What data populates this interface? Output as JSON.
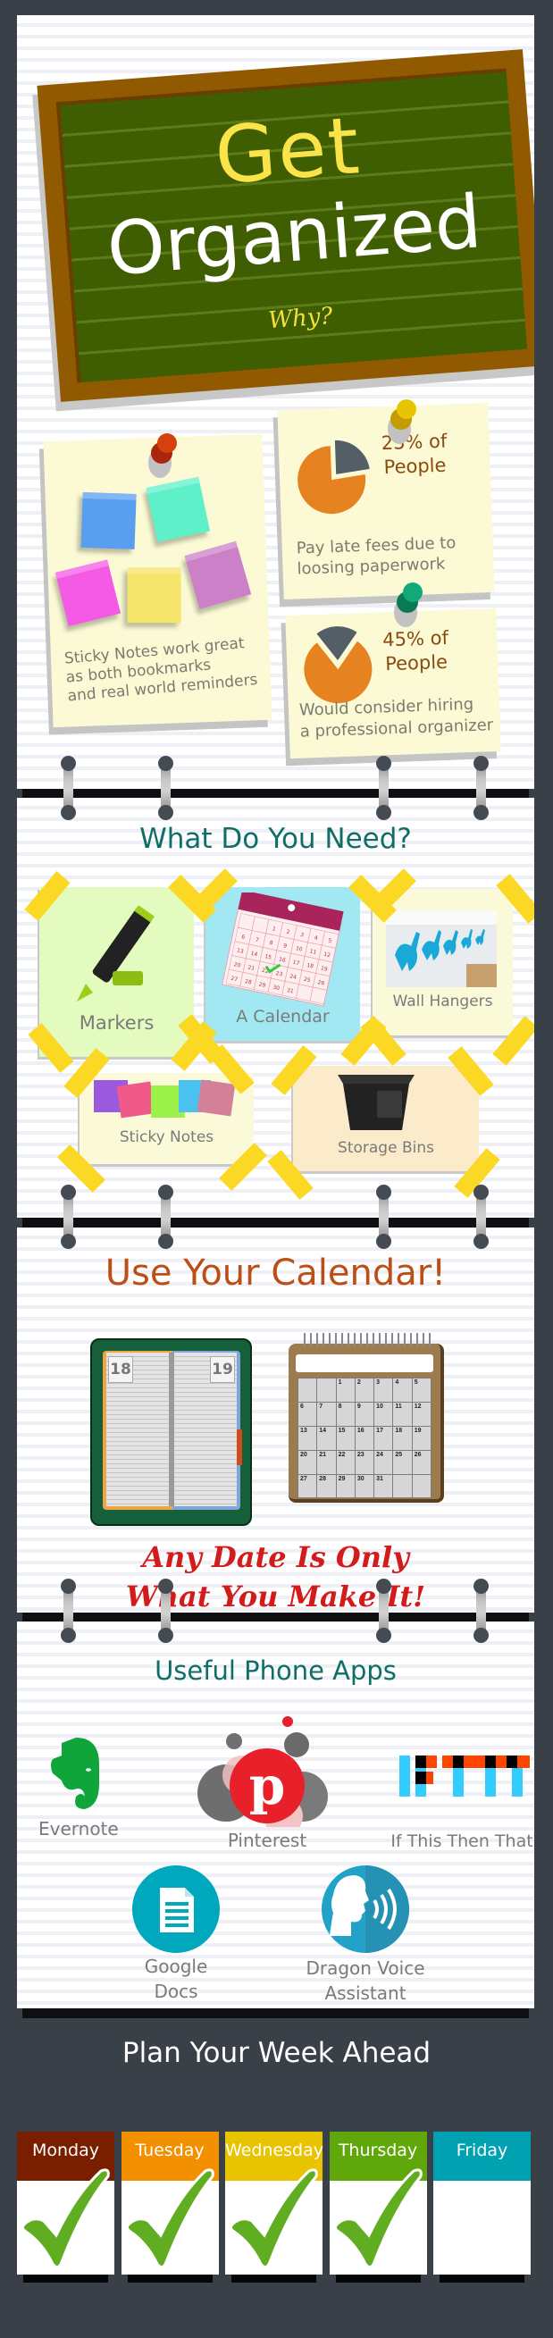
{
  "header": {
    "title_line1": "Get",
    "title_line2": "Organized",
    "subtitle": "Why?"
  },
  "why_section": {
    "sticky_note": {
      "text": "Sticky Notes work great\nas both bookmarks\nand real world reminders",
      "note_colors": [
        "#5a9ef0",
        "#5ef0c8",
        "#f55ae6",
        "#f5e56a",
        "#cc80c8"
      ]
    },
    "stats": [
      {
        "percent": 23,
        "headline_line1": "23% of",
        "headline_line2": "People",
        "description_line1": "Pay late fees due to",
        "description_line2": "loosing paperwork",
        "pin_color": "#e8c500"
      },
      {
        "percent": 45,
        "headline_line1": "45% of",
        "headline_line2": "People",
        "description_line1": "Would consider hiring",
        "description_line2": "a professional organizer",
        "pin_color": "#0e9a6a"
      }
    ],
    "colors": {
      "pie_main": "#e68320",
      "pie_slice": "#535e66"
    }
  },
  "needs_section": {
    "title": "What Do You Need?",
    "items": [
      {
        "label": "Markers",
        "bg": "#e3fbbf"
      },
      {
        "label": "A Calendar",
        "bg": "#a2e8f3"
      },
      {
        "label": "Wall Hangers",
        "bg": "#fbfad8"
      },
      {
        "label": "Sticky Notes",
        "bg": "#fbfad8"
      },
      {
        "label": "Storage Bins",
        "bg": "#fcebcb"
      }
    ],
    "calendar_icon_days": [
      "1",
      "2",
      "3",
      "4",
      "5",
      "6",
      "7",
      "8",
      "9",
      "10",
      "11",
      "12",
      "13",
      "14",
      "15",
      "16",
      "17",
      "18",
      "19",
      "20",
      "21",
      "22",
      "23",
      "24",
      "25",
      "26",
      "27",
      "28",
      "29",
      "30",
      "31"
    ]
  },
  "calendar_section": {
    "title": "Use Your Calendar!",
    "planner_pages": [
      "18",
      "19"
    ],
    "month_days": [
      [
        "",
        "",
        "1",
        "2",
        "3",
        "4",
        "5"
      ],
      [
        "6",
        "7",
        "8",
        "9",
        "10",
        "11",
        "12"
      ],
      [
        "13",
        "14",
        "15",
        "16",
        "17",
        "18",
        "19"
      ],
      [
        "20",
        "21",
        "22",
        "23",
        "24",
        "25",
        "26"
      ],
      [
        "27",
        "28",
        "29",
        "30",
        "31",
        "",
        ""
      ]
    ],
    "slogan_line1": "Any Date Is Only",
    "slogan_line2": "What You Make It!"
  },
  "apps_section": {
    "title": "Useful Phone Apps",
    "apps": [
      {
        "name": "Evernote",
        "icon": "evernote-icon",
        "color": "#0fa53a"
      },
      {
        "name": "Pinterest",
        "icon": "pinterest-icon",
        "color": "#e8202a"
      },
      {
        "name": "If This Then That",
        "icon": "ifttt-icon",
        "color": "#33ccff"
      },
      {
        "name_line1": "Google",
        "name_line2": "Docs",
        "icon": "google-docs-icon",
        "color": "#00a8bd"
      },
      {
        "name_line1": "Dragon Voice",
        "name_line2": "Assistant",
        "icon": "dragon-voice-icon",
        "color": "#22a2c9"
      }
    ]
  },
  "week_section": {
    "title": "Plan Your Week Ahead",
    "days": [
      {
        "label": "Monday",
        "color": "#7a1e00",
        "checked": true
      },
      {
        "label": "Tuesday",
        "color": "#f39000",
        "checked": true
      },
      {
        "label": "Wednesday",
        "color": "#e8c400",
        "checked": true
      },
      {
        "label": "Thursday",
        "color": "#5fa70a",
        "checked": true
      },
      {
        "label": "Friday",
        "color": "#00a2b2",
        "checked": false
      }
    ],
    "check_color": "#61ad21"
  }
}
